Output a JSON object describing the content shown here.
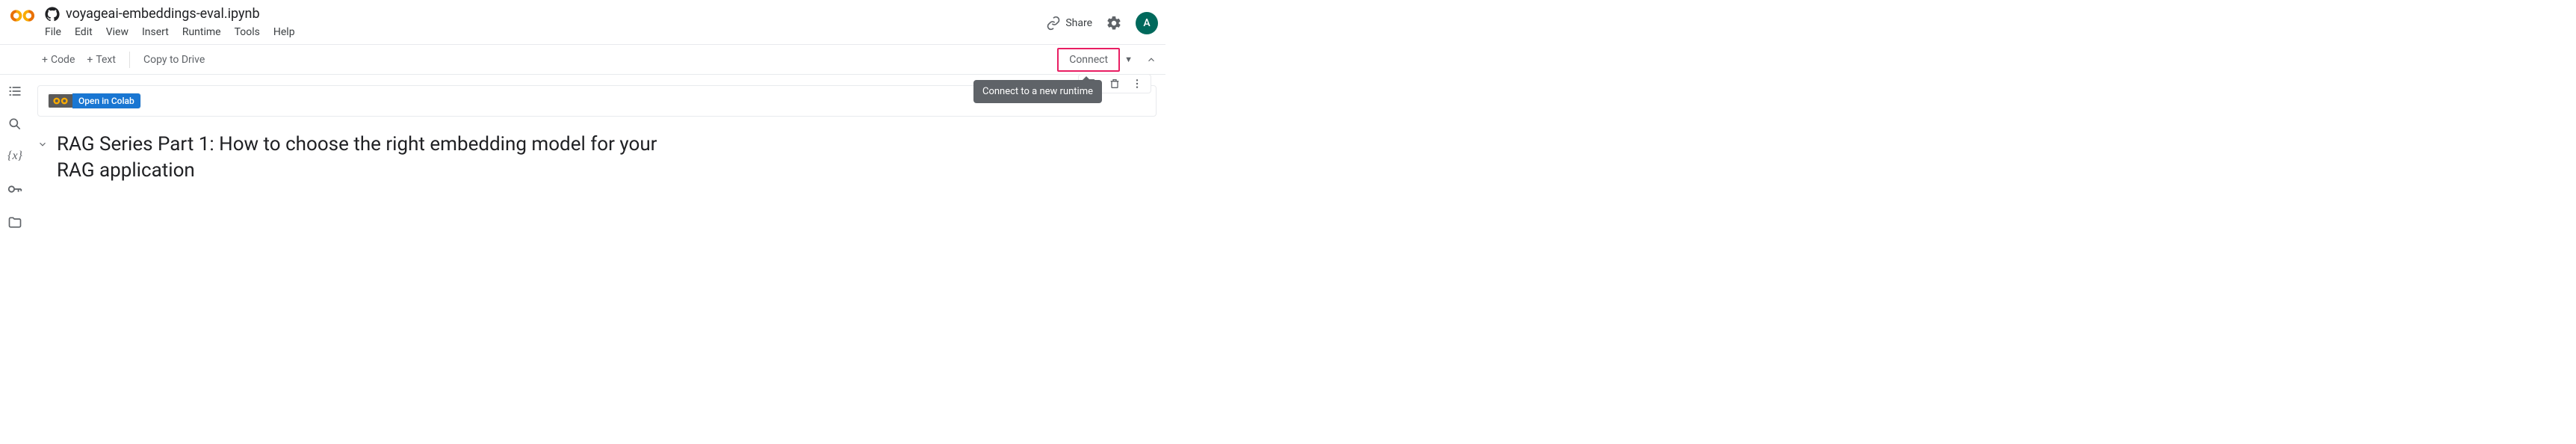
{
  "header": {
    "notebook_title": "voyageai-embeddings-eval.ipynb",
    "menus": [
      "File",
      "Edit",
      "View",
      "Insert",
      "Runtime",
      "Tools",
      "Help"
    ],
    "share_label": "Share",
    "avatar_initial": "A"
  },
  "toolbar": {
    "add_code_prefix": "+",
    "add_code_label": "Code",
    "add_text_prefix": "+",
    "add_text_label": "Text",
    "copy_label": "Copy to Drive",
    "connect_label": "Connect"
  },
  "badge": {
    "open_in_colab": "Open in Colab"
  },
  "tooltip": {
    "connect_new_runtime": "Connect to a new runtime"
  },
  "content": {
    "heading": "RAG Series Part 1: How to choose the right embedding model for your RAG application"
  }
}
